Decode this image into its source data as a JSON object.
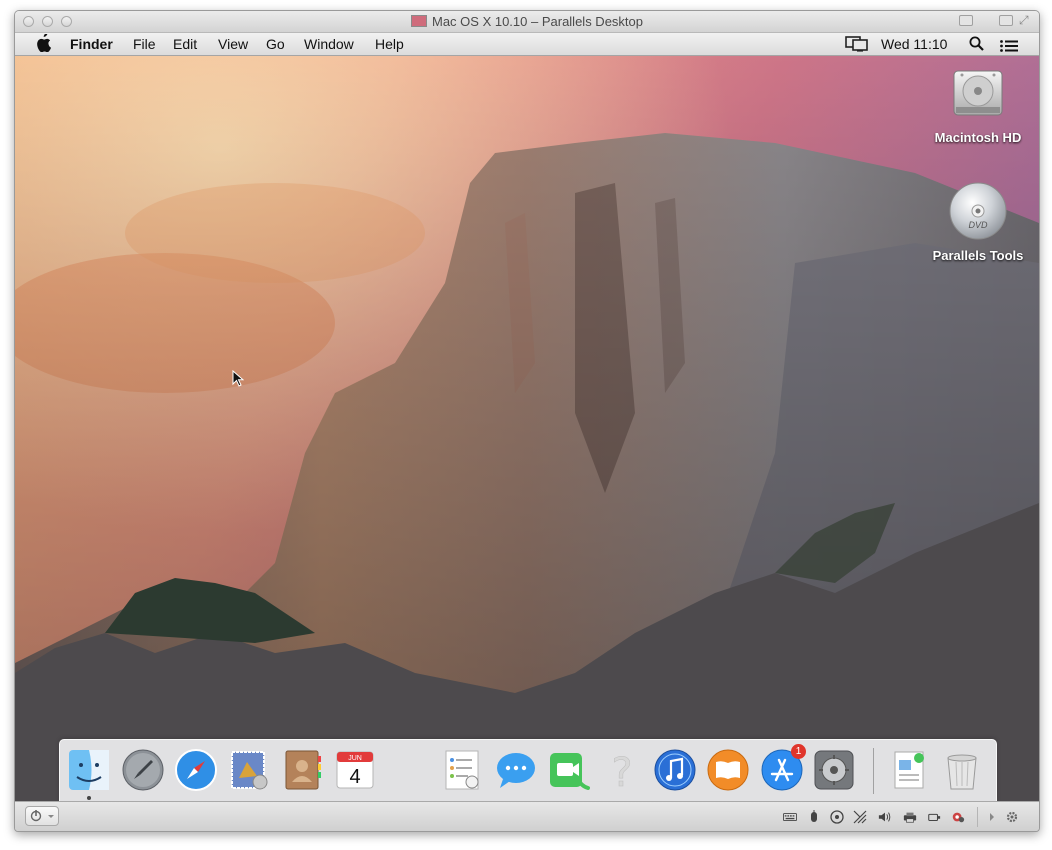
{
  "window": {
    "title": "Mac OS X 10.10 – Parallels Desktop"
  },
  "menubar": {
    "app_name": "Finder",
    "items": [
      "File",
      "Edit",
      "View",
      "Go",
      "Window",
      "Help"
    ],
    "clock": "Wed 11:10"
  },
  "desktop": {
    "icons": [
      {
        "label": "Macintosh HD",
        "icon": "hard-drive-icon"
      },
      {
        "label": "Parallels Tools",
        "icon": "dvd-icon"
      }
    ]
  },
  "dock": {
    "apps": [
      "Finder",
      "Launchpad",
      "Safari",
      "Mail",
      "Contacts",
      "Calendar",
      "Reminders",
      "Messages",
      "FaceTime",
      "Help",
      "iTunes",
      "iBooks",
      "App Store",
      "System Preferences",
      "Preview",
      "Trash"
    ],
    "calendar": {
      "month": "JUN",
      "day": "4"
    },
    "app_store_badge": "1"
  },
  "colors": {
    "sky_top": "#c8738a",
    "sky_glow": "#f0a670",
    "rock": "#8c8680"
  }
}
